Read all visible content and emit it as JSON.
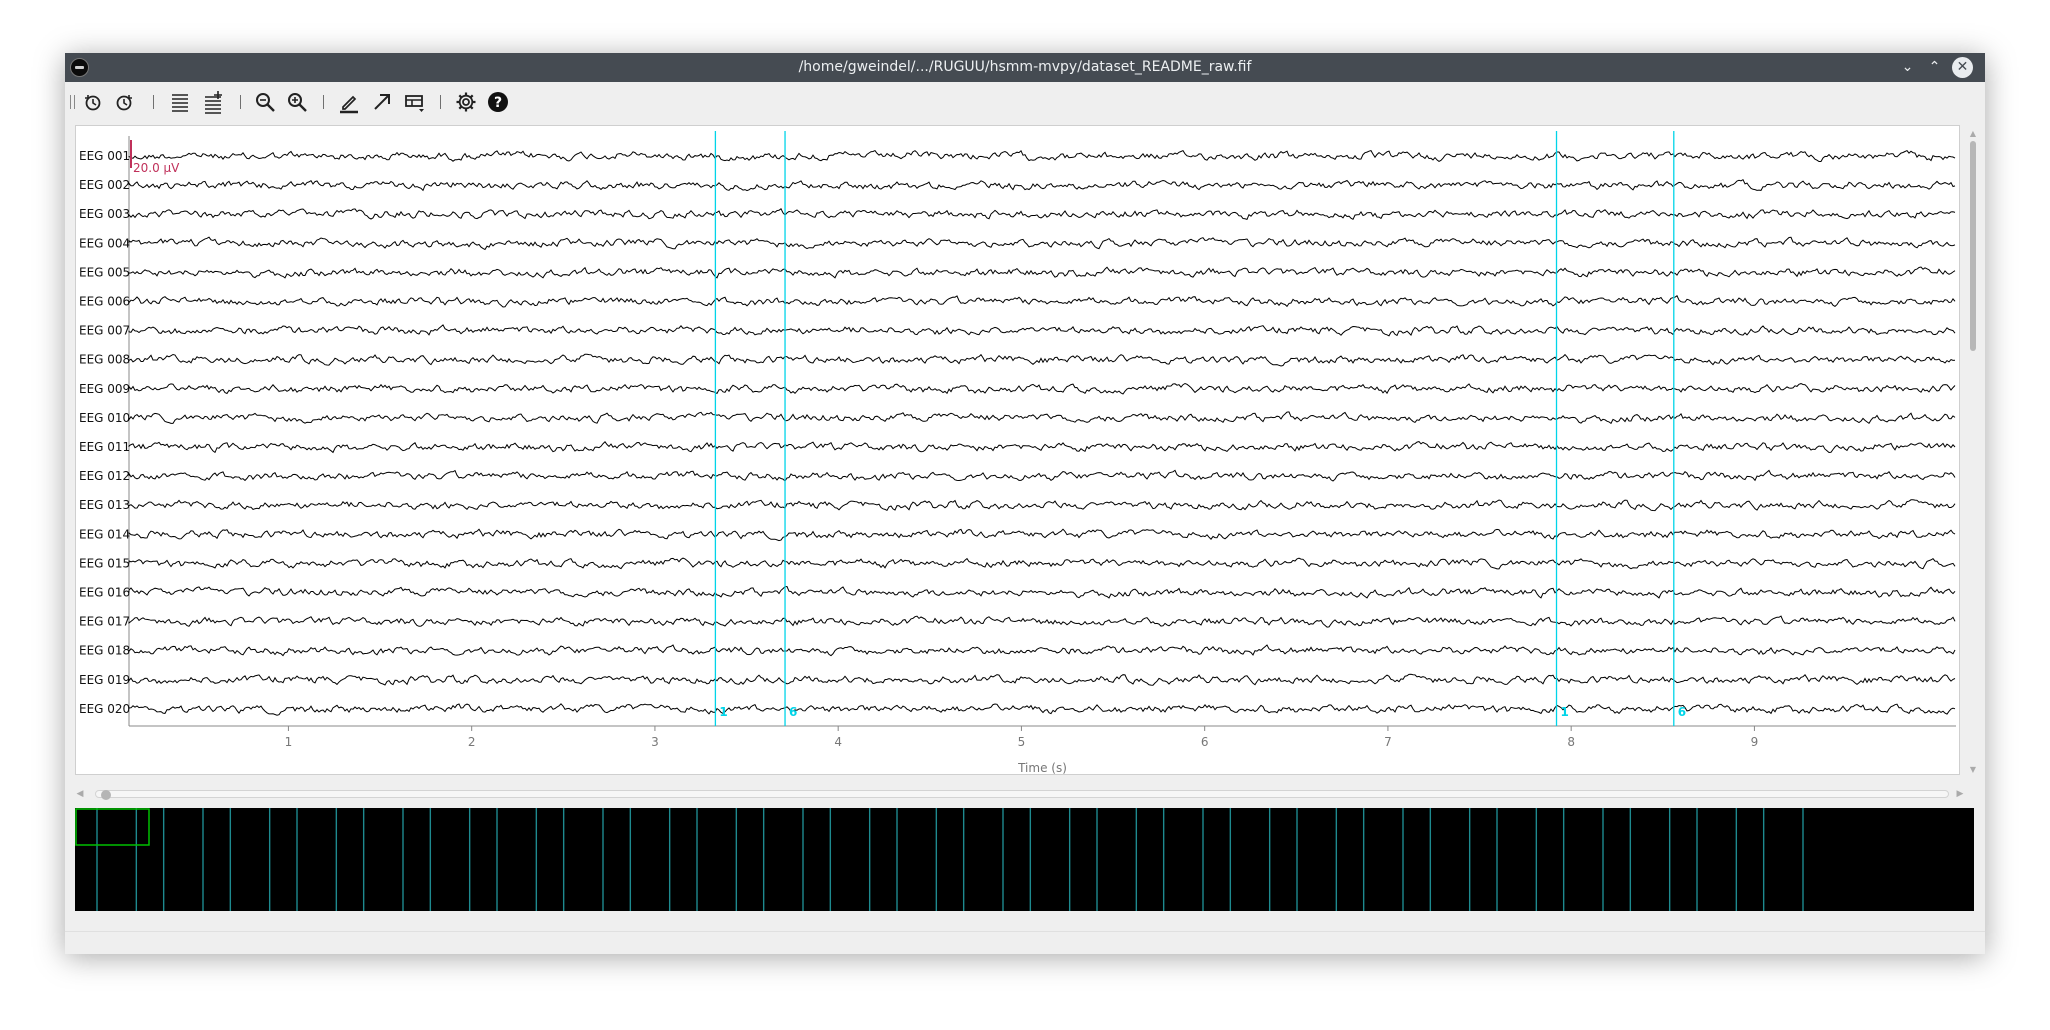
{
  "window": {
    "title": "/home/gweindel/.../RUGUU/hsmm-mvpy/dataset_README_raw.fif"
  },
  "titlebar_buttons": {
    "minimize": "⌄",
    "maximize": "⌃",
    "close": "✕"
  },
  "toolbar": {
    "items": [
      {
        "name": "rewind-icon"
      },
      {
        "name": "forward-icon"
      },
      {
        "name": "fewer-channels-icon"
      },
      {
        "name": "more-channels-icon"
      },
      {
        "name": "zoom-out-icon"
      },
      {
        "name": "zoom-in-icon"
      },
      {
        "name": "annotation-mode-icon"
      },
      {
        "name": "projector-arrow-icon"
      },
      {
        "name": "overview-bar-icon"
      },
      {
        "name": "settings-gear-icon"
      },
      {
        "name": "help-icon"
      }
    ]
  },
  "plot": {
    "channels": [
      "EEG 001",
      "EEG 002",
      "EEG 003",
      "EEG 004",
      "EEG 005",
      "EEG 006",
      "EEG 007",
      "EEG 008",
      "EEG 009",
      "EEG 010",
      "EEG 011",
      "EEG 012",
      "EEG 013",
      "EEG 014",
      "EEG 015",
      "EEG 016",
      "EEG 017",
      "EEG 018",
      "EEG 019",
      "EEG 020"
    ],
    "scalebar_label": "20.0 µV",
    "xlabel": "Time (s)",
    "xticks": [
      "1",
      "2",
      "3",
      "4",
      "5",
      "6",
      "7",
      "8",
      "9"
    ],
    "events": [
      {
        "time": 3.33,
        "label": "1"
      },
      {
        "time": 3.71,
        "label": "6"
      },
      {
        "time": 7.92,
        "label": "1"
      },
      {
        "time": 8.56,
        "label": "6"
      }
    ],
    "colors": {
      "trace": "#000000",
      "event": "#00d4e8",
      "scalebar": "#c0305a",
      "tick": "#777777"
    }
  },
  "overview": {
    "event_lines": 52,
    "view_color": "#00c000"
  }
}
